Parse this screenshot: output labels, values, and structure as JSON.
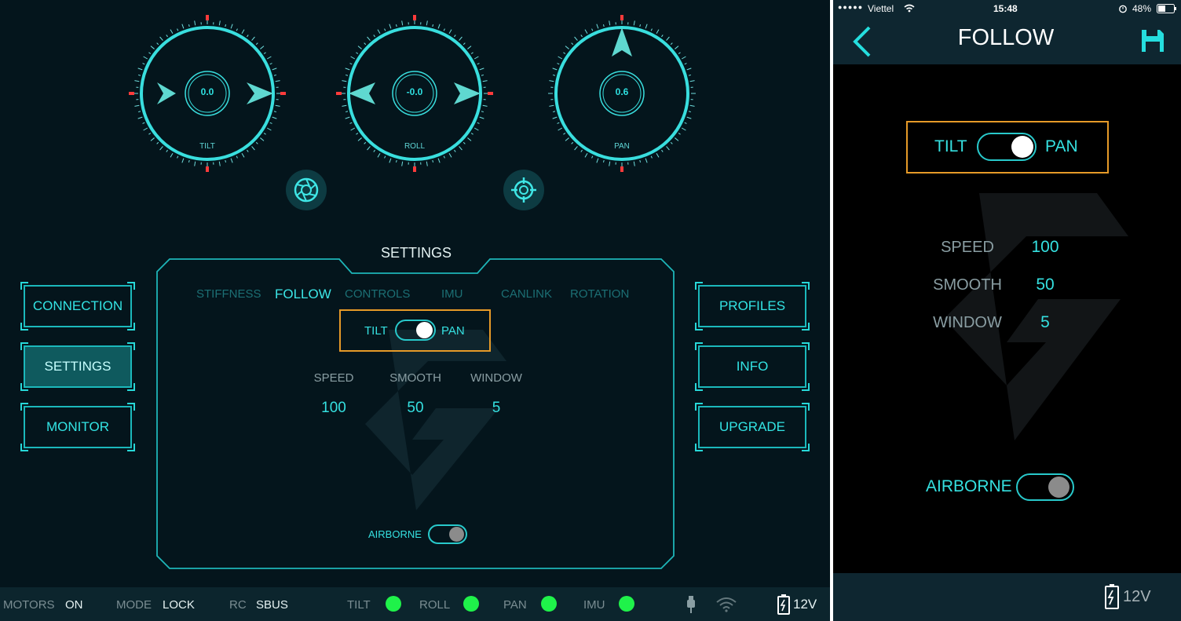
{
  "tablet": {
    "dials": [
      {
        "label": "TILT",
        "value": "0.0"
      },
      {
        "label": "ROLL",
        "value": "-0.0"
      },
      {
        "label": "PAN",
        "value": "0.6"
      }
    ],
    "left_nav": [
      "CONNECTION",
      "SETTINGS",
      "MONITOR"
    ],
    "left_nav_active": "SETTINGS",
    "right_nav": [
      "PROFILES",
      "INFO",
      "UPGRADE"
    ],
    "settings": {
      "title": "SETTINGS",
      "tabs": [
        "STIFFNESS",
        "FOLLOW",
        "CONTROLS",
        "IMU",
        "CANLINK",
        "ROTATION"
      ],
      "active_tab": "FOLLOW",
      "toggle_left": "TILT",
      "toggle_right": "PAN",
      "params": [
        {
          "label": "SPEED",
          "value": "100"
        },
        {
          "label": "SMOOTH",
          "value": "50"
        },
        {
          "label": "WINDOW",
          "value": "5"
        }
      ],
      "airborne_label": "AIRBORNE"
    },
    "status": {
      "motors_label": "MOTORS",
      "motors_value": "ON",
      "mode_label": "MODE",
      "mode_value": "LOCK",
      "rc_label": "RC",
      "rc_value": "SBUS",
      "leds": [
        "TILT",
        "ROLL",
        "PAN",
        "IMU"
      ],
      "battery": "12V"
    }
  },
  "phone": {
    "carrier": "Viettel",
    "time": "15:48",
    "battery_pct": "48%",
    "title": "FOLLOW",
    "toggle_left": "TILT",
    "toggle_right": "PAN",
    "params": [
      {
        "label": "SPEED",
        "value": "100"
      },
      {
        "label": "SMOOTH",
        "value": "50"
      },
      {
        "label": "WINDOW",
        "value": "5"
      }
    ],
    "airborne_label": "AIRBORNE",
    "battery": "12V"
  },
  "colors": {
    "accent_cyan": "#35e0e0",
    "highlight_orange": "#e69a28",
    "led_green": "#1ff24a",
    "marker_red": "#ff3b3b"
  }
}
